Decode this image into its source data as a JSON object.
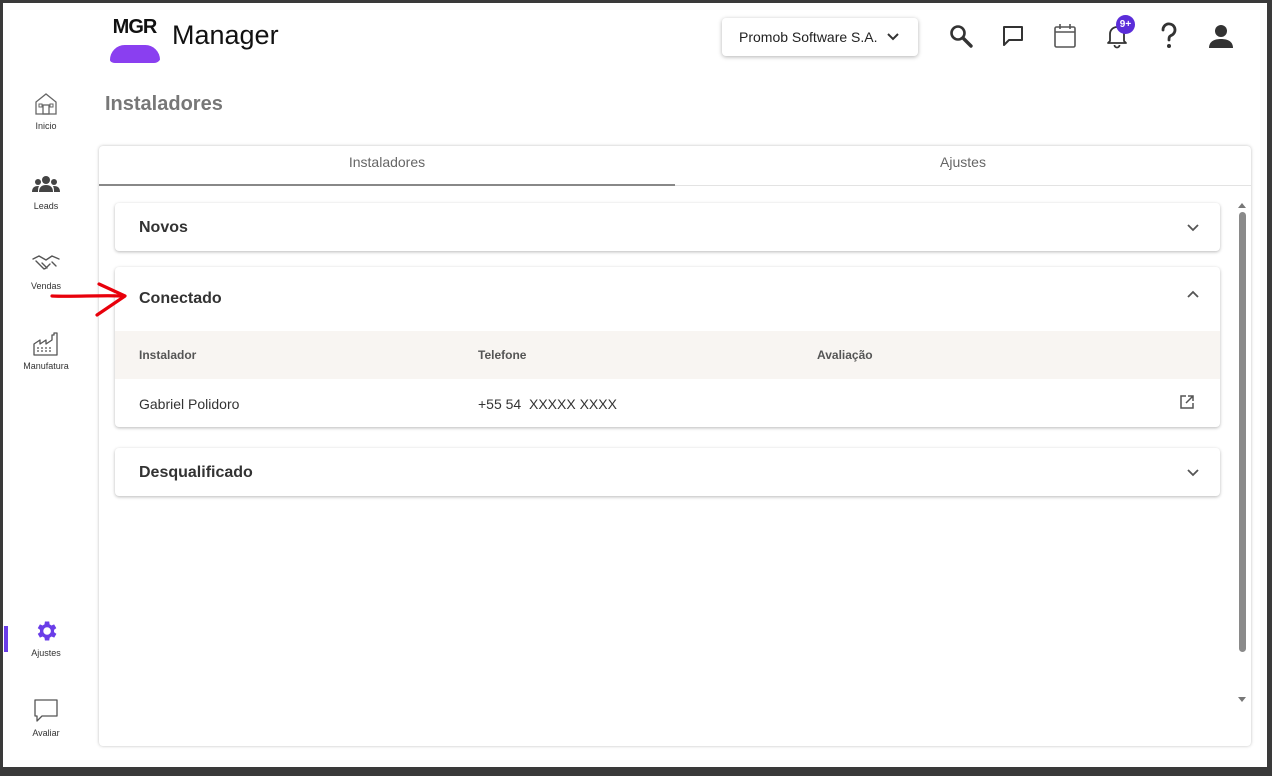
{
  "app": {
    "logo_text": "MGR",
    "title": "Manager"
  },
  "header": {
    "company": "Promob Software S.A.",
    "notification_badge": "9+",
    "icons": [
      "search-icon",
      "chat-icon",
      "calendar-icon",
      "bell-icon",
      "help-icon",
      "user-icon"
    ]
  },
  "sidebar": {
    "items": [
      {
        "label": "Inicio",
        "icon": "home-icon"
      },
      {
        "label": "Leads",
        "icon": "people-icon"
      },
      {
        "label": "Vendas",
        "icon": "handshake-icon"
      },
      {
        "label": "Manufatura",
        "icon": "factory-icon"
      },
      {
        "label": "Ajustes",
        "icon": "gear-icon"
      },
      {
        "label": "Avaliar",
        "icon": "feedback-icon"
      }
    ],
    "active": "Ajustes"
  },
  "page": {
    "title": "Instaladores"
  },
  "tabs": [
    {
      "label": "Instaladores"
    },
    {
      "label": "Ajustes"
    }
  ],
  "panels": {
    "novos": {
      "title": "Novos"
    },
    "conectado": {
      "title": "Conectado",
      "columns": [
        "Instalador",
        "Telefone",
        "Avaliação"
      ],
      "rows": [
        {
          "instalador": "Gabriel Polidoro",
          "telefone": "+55 54  XXXXX XXXX",
          "avaliacao": ""
        }
      ]
    },
    "desqualificado": {
      "title": "Desqualificado"
    }
  },
  "colors": {
    "accent": "#6a3de8",
    "annotation_arrow": "#e8000b"
  }
}
